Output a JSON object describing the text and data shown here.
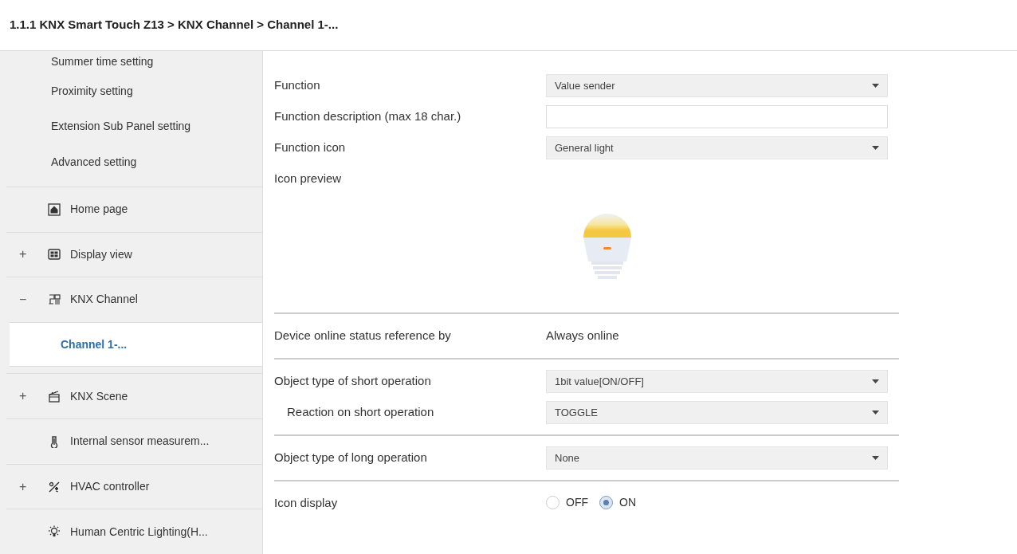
{
  "breadcrumb": "1.1.1 KNX Smart Touch Z13 > KNX Channel  > Channel 1-...",
  "sidebar": {
    "items": [
      {
        "label": "Summer time setting",
        "kind": "sub",
        "selected": false
      },
      {
        "label": "Proximity setting",
        "kind": "sub",
        "selected": false
      },
      {
        "label": "Extension Sub Panel setting",
        "kind": "sub",
        "selected": false
      },
      {
        "label": "Advanced setting",
        "kind": "sub",
        "selected": false
      },
      {
        "label": "Home page",
        "kind": "group",
        "selected": false
      },
      {
        "label": "Display view",
        "kind": "group",
        "expander": "+",
        "selected": false
      },
      {
        "label": "KNX Channel",
        "kind": "group",
        "expander": "−",
        "selected": false
      },
      {
        "label": "Channel 1-...",
        "kind": "sub",
        "selected": true
      },
      {
        "label": "KNX Scene",
        "kind": "group",
        "expander": "+",
        "selected": false
      },
      {
        "label": "Internal sensor measurem...",
        "kind": "group",
        "selected": false
      },
      {
        "label": "HVAC controller",
        "kind": "group",
        "expander": "+",
        "selected": false
      },
      {
        "label": "Human Centric Lighting(H...",
        "kind": "group",
        "selected": false
      }
    ]
  },
  "sections": [
    {
      "rows": [
        {
          "kind": "dropdown",
          "label": "Function",
          "value": "Value sender"
        },
        {
          "kind": "input",
          "label": "Function description (max 18 char.)"
        },
        {
          "kind": "dropdown",
          "label": "Function icon",
          "value": "General light"
        },
        {
          "kind": "preview",
          "label": "Icon preview"
        }
      ]
    },
    {
      "rows": [
        {
          "kind": "static",
          "label": "Device online status reference by",
          "value": "Always online"
        }
      ]
    },
    {
      "rows": [
        {
          "kind": "dropdown",
          "label": "Object type of short operation",
          "value": "1bit value[ON/OFF]"
        },
        {
          "kind": "dropdown",
          "label": "Reaction on short operation",
          "value": "TOGGLE",
          "indented": true
        }
      ]
    },
    {
      "rows": [
        {
          "kind": "dropdown",
          "label": "Object type of long operation",
          "value": "None"
        }
      ]
    },
    {
      "rows": [
        {
          "kind": "radio",
          "label": "Icon display",
          "options": [
            {
              "label": "OFF",
              "selected": false
            },
            {
              "label": "ON",
              "selected": true
            }
          ]
        }
      ]
    }
  ]
}
